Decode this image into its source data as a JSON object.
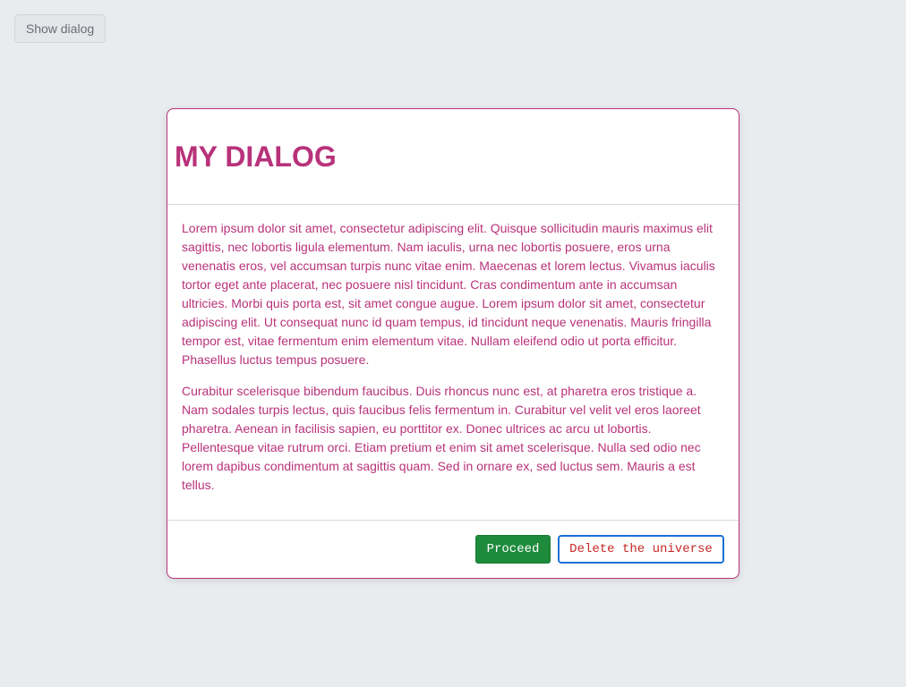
{
  "toolbar": {
    "show_dialog_label": "Show dialog"
  },
  "dialog": {
    "title": "MY DIALOG",
    "paragraphs": [
      "Lorem ipsum dolor sit amet, consectetur adipiscing elit. Quisque sollicitudin mauris maximus elit sagittis, nec lobortis ligula elementum. Nam iaculis, urna nec lobortis posuere, eros urna venenatis eros, vel accumsan turpis nunc vitae enim. Maecenas et lorem lectus. Vivamus iaculis tortor eget ante placerat, nec posuere nisl tincidunt. Cras condimentum ante in accumsan ultricies. Morbi quis porta est, sit amet congue augue. Lorem ipsum dolor sit amet, consectetur adipiscing elit. Ut consequat nunc id quam tempus, id tincidunt neque venenatis. Mauris fringilla tempor est, vitae fermentum enim elementum vitae. Nullam eleifend odio ut porta efficitur. Phasellus luctus tempus posuere.",
      "Curabitur scelerisque bibendum faucibus. Duis rhoncus nunc est, at pharetra eros tristique a. Nam sodales turpis lectus, quis faucibus felis fermentum in. Curabitur vel velit vel eros laoreet pharetra. Aenean in facilisis sapien, eu porttitor ex. Donec ultrices ac arcu ut lobortis. Pellentesque vitae rutrum orci. Etiam pretium et enim sit amet scelerisque. Nulla sed odio nec lorem dapibus condimentum at sagittis quam. Sed in ornare ex, sed luctus sem. Mauris a est tellus."
    ],
    "proceed_label": "Proceed",
    "delete_label": "Delete the universe"
  },
  "colors": {
    "background": "#e9ecef",
    "accent": "#b8327a",
    "proceed": "#1e8a3c",
    "danger_text": "#c62828",
    "focus_ring": "#1c6fd6"
  }
}
